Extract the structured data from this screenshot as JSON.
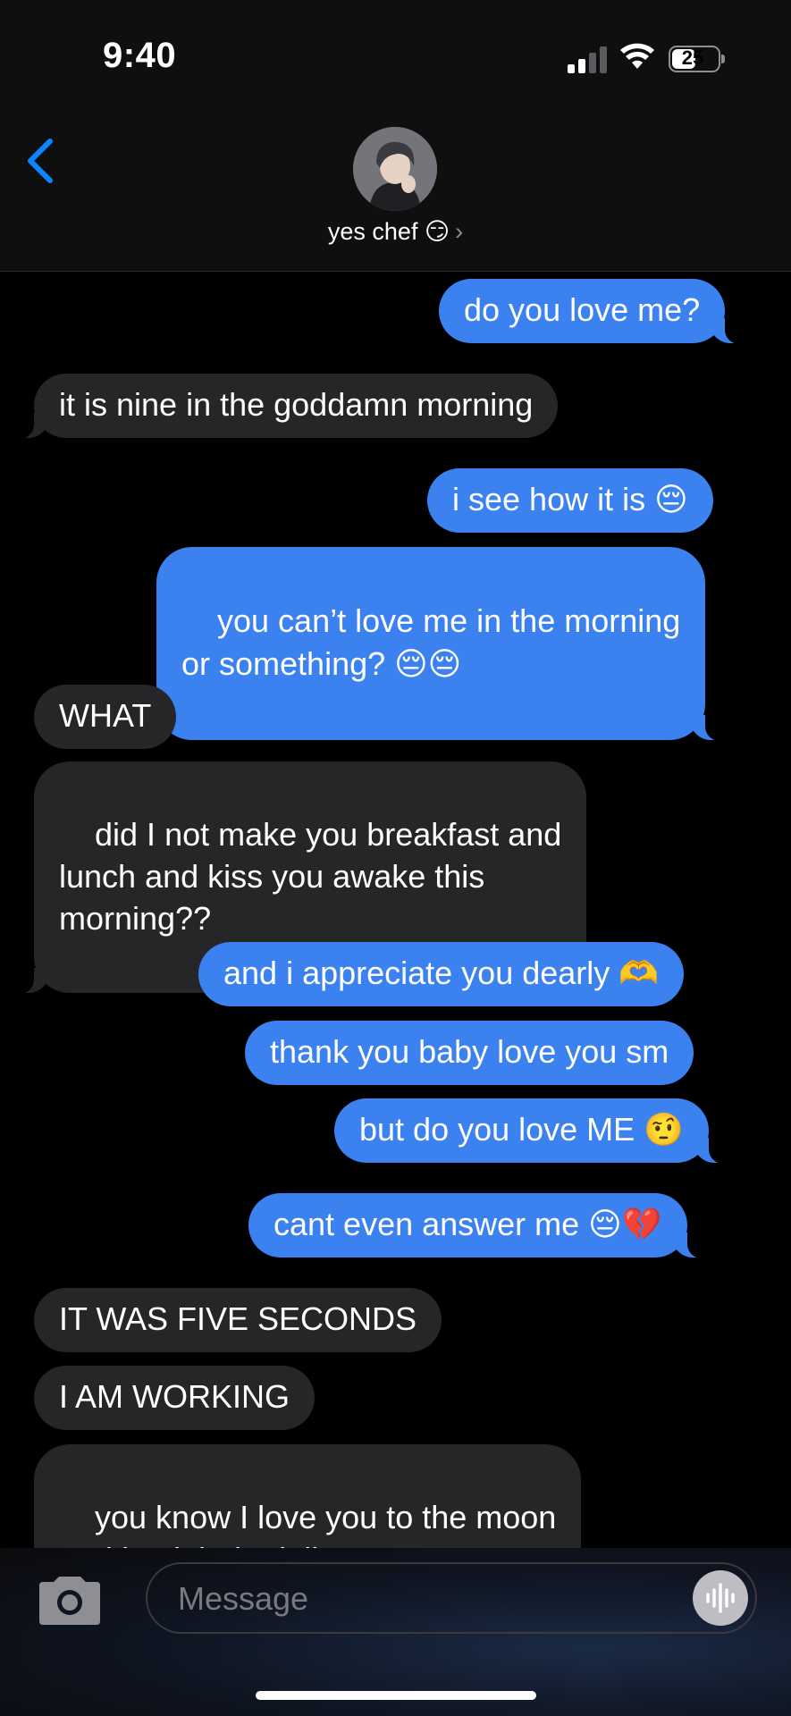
{
  "status": {
    "time": "9:40",
    "battery": "25"
  },
  "header": {
    "back_icon": "chevron-left-icon",
    "contact_name": "yes chef 😏",
    "details_chevron": "›"
  },
  "messages": [
    {
      "dir": "out",
      "text": "do you love me?"
    },
    {
      "dir": "in",
      "text": "it is nine in the goddamn morning"
    },
    {
      "dir": "out",
      "text": "i see how it is 😔"
    },
    {
      "dir": "out",
      "text": "you can’t love me in the morning\nor something? 😔😔"
    },
    {
      "dir": "in",
      "text": "WHAT"
    },
    {
      "dir": "in",
      "text": "did I not make you breakfast and\nlunch and kiss you awake this\nmorning??"
    },
    {
      "dir": "out",
      "text": "and i appreciate you dearly 🫶"
    },
    {
      "dir": "out",
      "text": "thank you baby love you sm"
    },
    {
      "dir": "out",
      "text": "but do you love ME 🤨"
    },
    {
      "dir": "out",
      "text": "cant even answer me 😔💔"
    },
    {
      "dir": "in",
      "text": "IT WAS FIVE SECONDS"
    },
    {
      "dir": "in",
      "text": "I AM WORKING"
    },
    {
      "dir": "in",
      "text": "you know I love you to the moon\nand back babydoll"
    }
  ],
  "input": {
    "placeholder": "Message"
  },
  "colors": {
    "outgoing": "#3b82f0",
    "incoming": "#262628",
    "accent": "#0a84ff"
  }
}
